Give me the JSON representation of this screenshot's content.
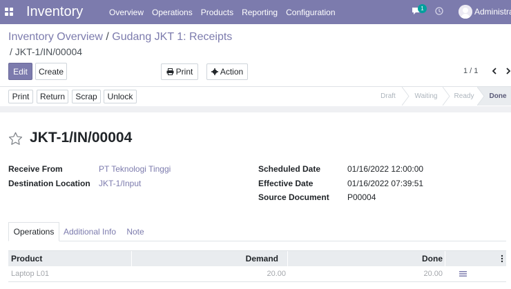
{
  "navbar": {
    "app_name": "Inventory",
    "menu": [
      "Overview",
      "Operations",
      "Products",
      "Reporting",
      "Configuration"
    ],
    "chat_badge": "1",
    "user_name": "Administrator",
    "accent_color": "#7c7bad"
  },
  "breadcrumb": {
    "parent": "Inventory Overview",
    "separator": " / ",
    "middle": "Gudang JKT 1: Receipts",
    "current": "/ JKT-1/IN/00004"
  },
  "actions": {
    "edit": "Edit",
    "create": "Create",
    "print": "Print",
    "action": "Action"
  },
  "pager": {
    "value": "1 / 1"
  },
  "statusbar": {
    "buttons": [
      "Print",
      "Return",
      "Scrap",
      "Unlock"
    ],
    "stages": [
      "Draft",
      "Waiting",
      "Ready",
      "Done"
    ],
    "active_stage": "Done"
  },
  "record": {
    "title": "JKT-1/IN/00004",
    "receive_from_label": "Receive From",
    "receive_from": "PT Teknologi Tinggi",
    "destination_label": "Destination Location",
    "destination": "JKT-1/Input",
    "scheduled_label": "Scheduled Date",
    "scheduled": "01/16/2022 12:00:00",
    "effective_label": "Effective Date",
    "effective": "01/16/2022 07:39:51",
    "source_label": "Source Document",
    "source": "P00004"
  },
  "tabs": [
    "Operations",
    "Additional Info",
    "Note"
  ],
  "table": {
    "headers": {
      "product": "Product",
      "demand": "Demand",
      "done": "Done"
    },
    "rows": [
      {
        "product": "Laptop L01",
        "demand": "20.00",
        "done": "20.00"
      }
    ]
  },
  "icons": {
    "apps": "apps-grid-icon",
    "chat": "chat-icon",
    "clock": "clock-icon",
    "print": "printer-icon",
    "action": "gear-icon",
    "star": "star-outline-icon",
    "details": "list-details-icon",
    "column_options": "vertical-dots-icon"
  }
}
